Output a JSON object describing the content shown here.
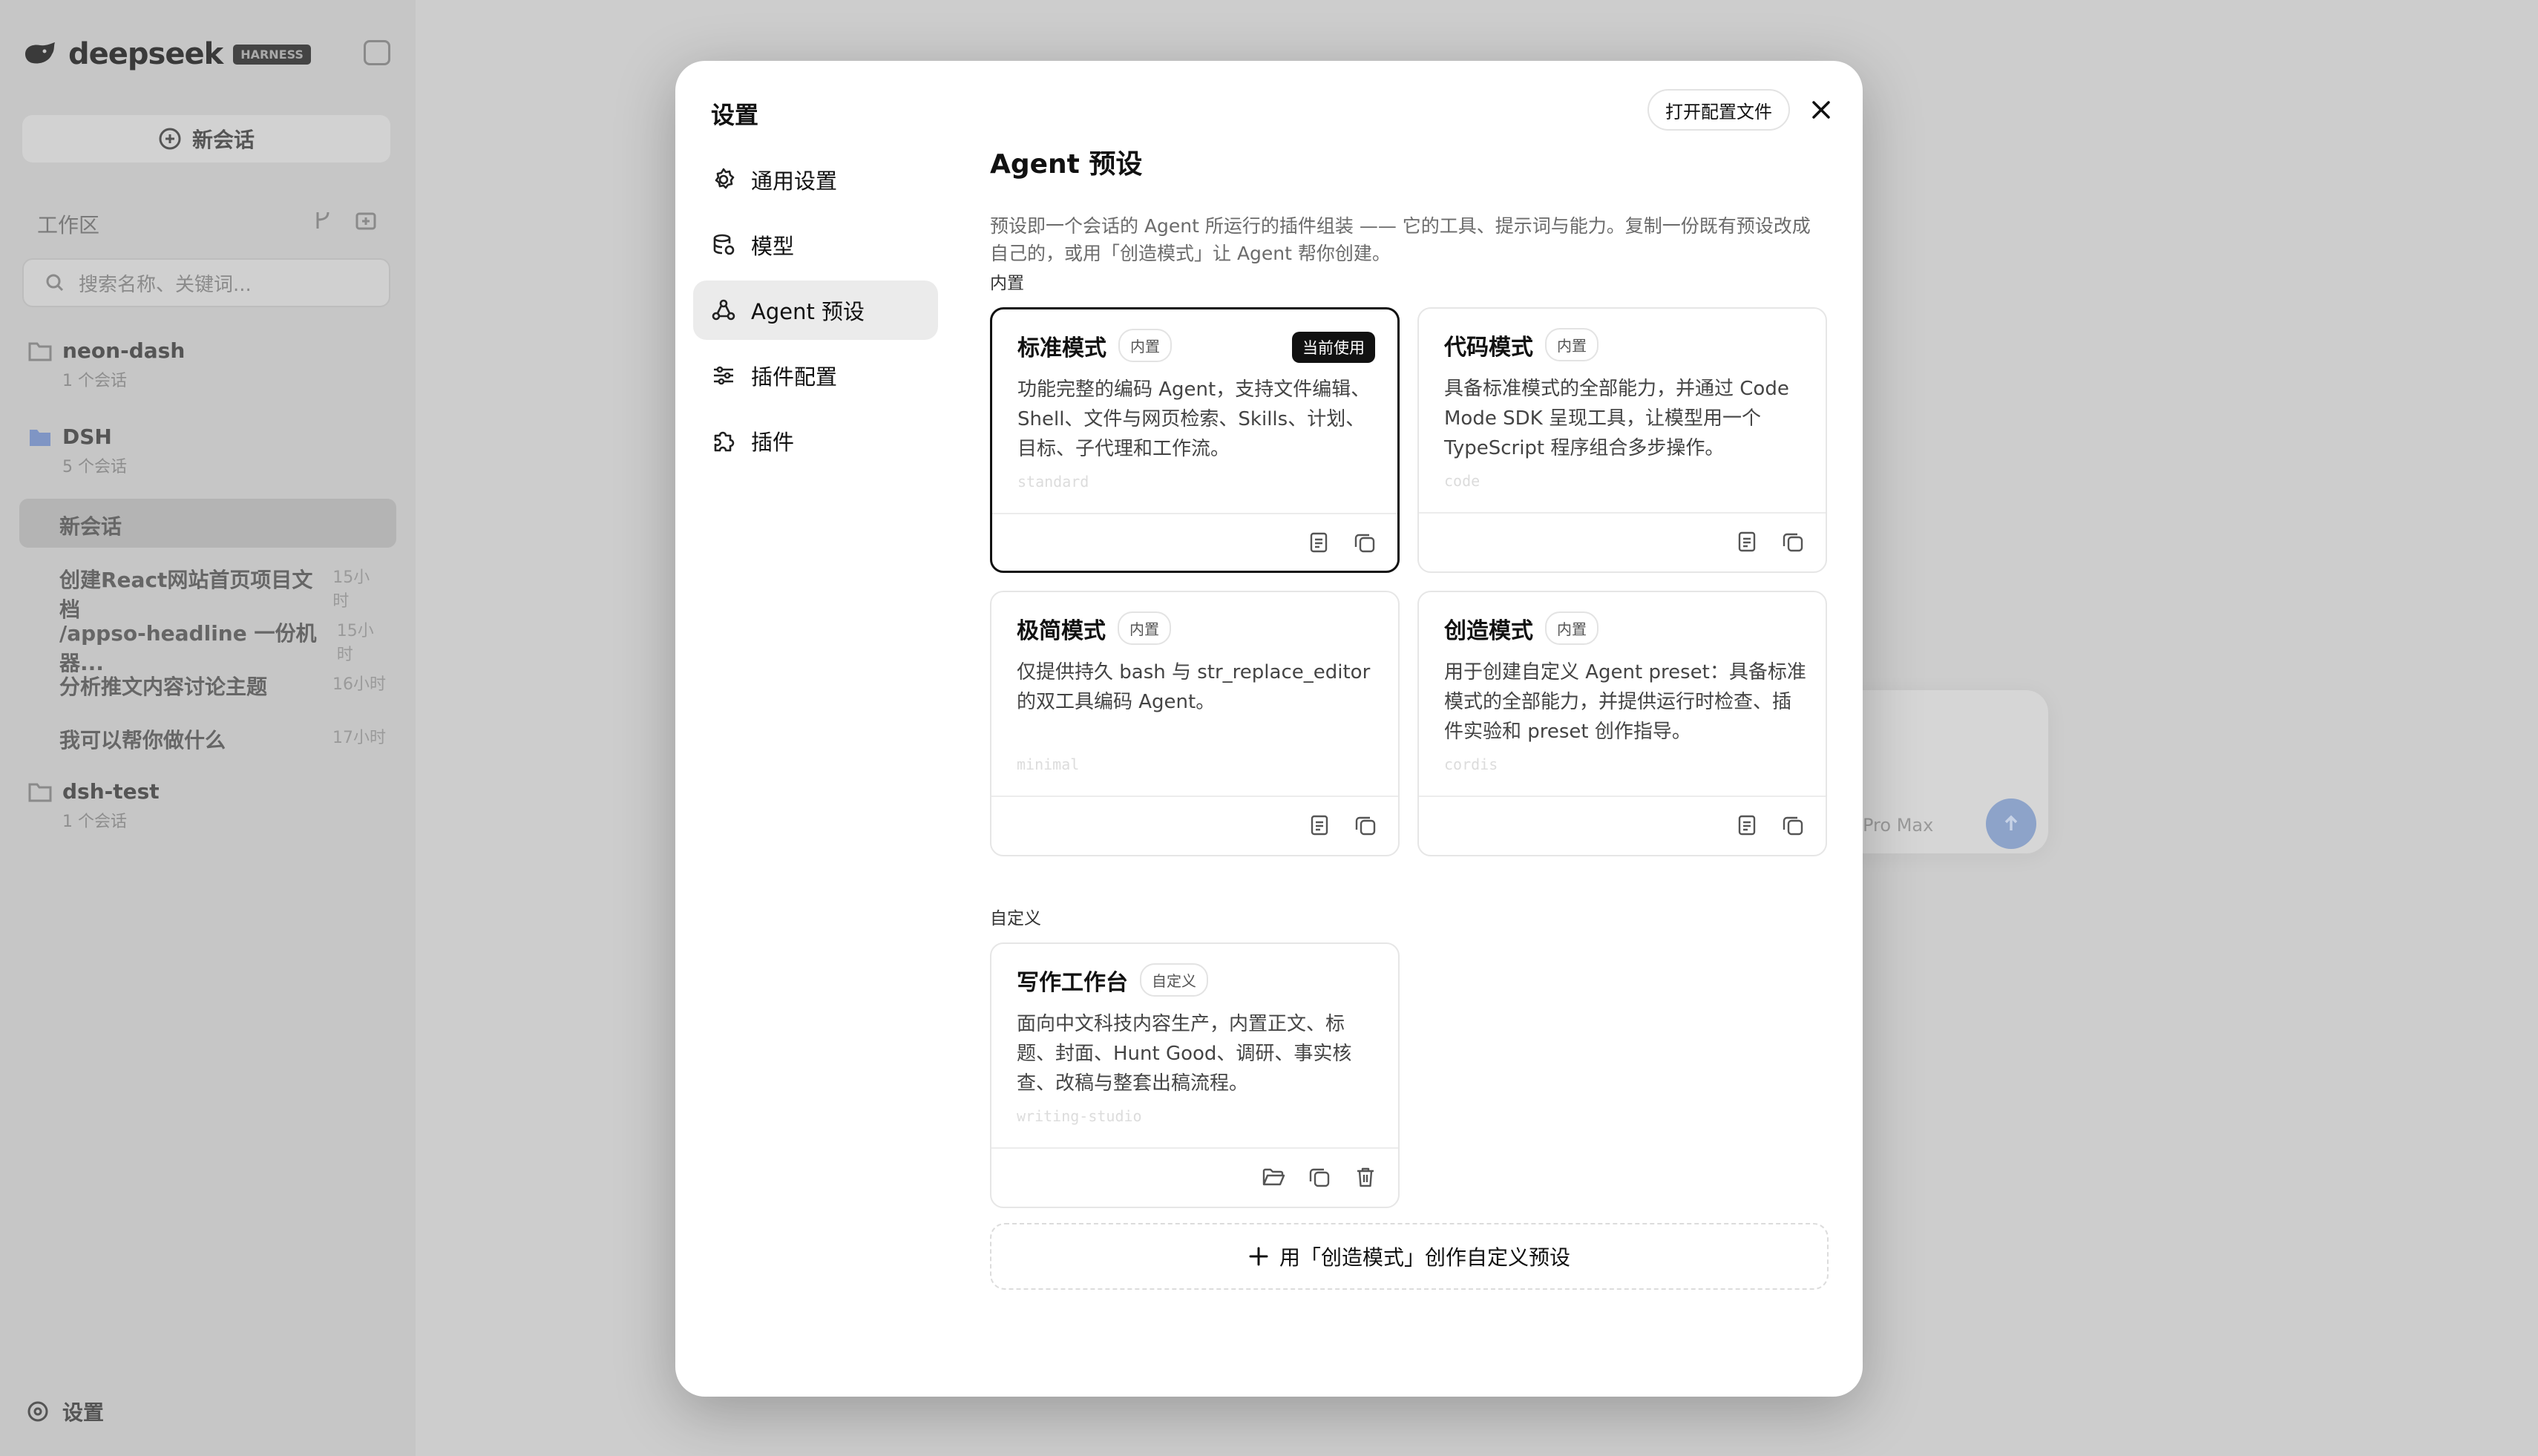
{
  "background": {
    "logo_word": "deepseek",
    "logo_tag": "HARNESS",
    "new_chat": "新会话",
    "workspace_label": "工作区",
    "search_placeholder": "搜索名称、关键词...",
    "groups": [
      {
        "name": "neon-dash",
        "count": "1 个会话"
      },
      {
        "name": "DSH",
        "count": "5 个会话"
      },
      {
        "name": "dsh-test",
        "count": "1 个会话"
      }
    ],
    "conversations": [
      {
        "title": "新会话",
        "time": ""
      },
      {
        "title": "创建React网站首页项目文档",
        "time": "15小时"
      },
      {
        "title": "/appso-headline 一份机器...",
        "time": "15小时"
      },
      {
        "title": "分析推文内容讨论主题",
        "time": "16小时"
      },
      {
        "title": "我可以帮你做什么",
        "time": "17小时"
      }
    ],
    "settings": "设置",
    "model_hint": "Pro Max"
  },
  "modal": {
    "title": "设置",
    "open_config": "打开配置文件",
    "nav": [
      {
        "label": "通用设置",
        "icon": "gear-icon"
      },
      {
        "label": "模型",
        "icon": "database-icon"
      },
      {
        "label": "Agent 预设",
        "icon": "agent-icon"
      },
      {
        "label": "插件配置",
        "icon": "sliders-icon"
      },
      {
        "label": "插件",
        "icon": "puzzle-icon"
      }
    ],
    "active_nav": "Agent 预设",
    "content": {
      "title": "Agent 预设",
      "description": "预设即一个会话的 Agent 所运行的插件组装 —— 它的工具、提示词与能力。复制一份既有预设改成自己的，或用「创造模式」让 Agent 帮你创建。",
      "builtin_label": "内置",
      "custom_label": "自定义",
      "current_badge": "当前使用",
      "builtin": [
        {
          "name": "标准模式",
          "badge": "内置",
          "desc": "功能完整的编码 Agent，支持文件编辑、Shell、文件与网页检索、Skills、计划、目标、子代理和工作流。",
          "slug": "standard",
          "current": true
        },
        {
          "name": "代码模式",
          "badge": "内置",
          "desc": "具备标准模式的全部能力，并通过 Code Mode SDK 呈现工具，让模型用一个 TypeScript 程序组合多步操作。",
          "slug": "code",
          "current": false
        },
        {
          "name": "极简模式",
          "badge": "内置",
          "desc": "仅提供持久 bash 与 str_replace_editor 的双工具编码 Agent。",
          "slug": "minimal",
          "current": false
        },
        {
          "name": "创造模式",
          "badge": "内置",
          "desc": "用于创建自定义 Agent preset：具备标准模式的全部能力，并提供运行时检查、插件实验和 preset 创作指导。",
          "slug": "cordis",
          "current": false
        }
      ],
      "custom": [
        {
          "name": "写作工作台",
          "badge": "自定义",
          "desc": "面向中文科技内容生产，内置正文、标题、封面、Hunt Good、调研、事实核查、改稿与整套出稿流程。",
          "slug": "writing-studio"
        }
      ],
      "create_button": "用「创造模式」创作自定义预设"
    }
  }
}
